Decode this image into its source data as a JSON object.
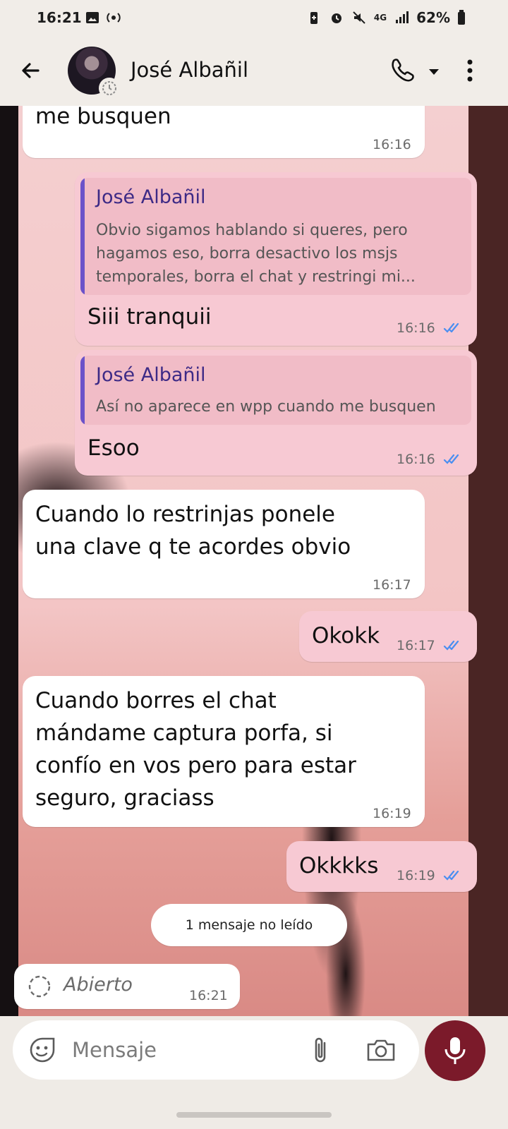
{
  "status_bar": {
    "time": "16:21",
    "network": "4G",
    "battery": "62%"
  },
  "header": {
    "contact_name": "José Albañil"
  },
  "messages": [
    {
      "text": "me busquen",
      "time": "16:16"
    },
    {
      "quote_name": "José Albañil",
      "quote_lines": [
        "Obvio sigamos hablando si queres, pero",
        "hagamos eso, borra desactivo los msjs",
        "temporales, borra el chat y restringi mi..."
      ],
      "text": "Siii tranquii",
      "time": "16:16"
    },
    {
      "quote_name": "José Albañil",
      "quote_lines": [
        "Así no aparece en wpp cuando me busquen"
      ],
      "text": "Esoo",
      "time": "16:16"
    },
    {
      "lines": [
        "Cuando lo restrinjas ponele",
        "una clave q te acordes obvio"
      ],
      "time": "16:17"
    },
    {
      "text": "Okokk",
      "time": "16:17"
    },
    {
      "lines": [
        "Cuando borres el chat",
        "mándame captura porfa, si",
        "confío en vos pero para estar",
        "seguro, graciass"
      ],
      "time": "16:19"
    },
    {
      "text": "Okkkks",
      "time": "16:19"
    },
    {
      "text": "Abierto",
      "time": "16:21"
    }
  ],
  "unread_label": "1 mensaje no leído",
  "composer": {
    "placeholder": "Mensaje"
  },
  "colors": {
    "outgoing_bubble": "#f7c9d3",
    "incoming_bubble": "#ffffff",
    "read_ticks": "#4a8ef0",
    "mic_button": "#7b1a2a",
    "quote_bar": "#6b52c9"
  },
  "icons": [
    "back-arrow-icon",
    "phone-icon",
    "dropdown-icon",
    "more-vert-icon",
    "sticker-icon",
    "paperclip-icon",
    "camera-icon",
    "microphone-icon",
    "double-check-icon",
    "view-once-icon"
  ]
}
